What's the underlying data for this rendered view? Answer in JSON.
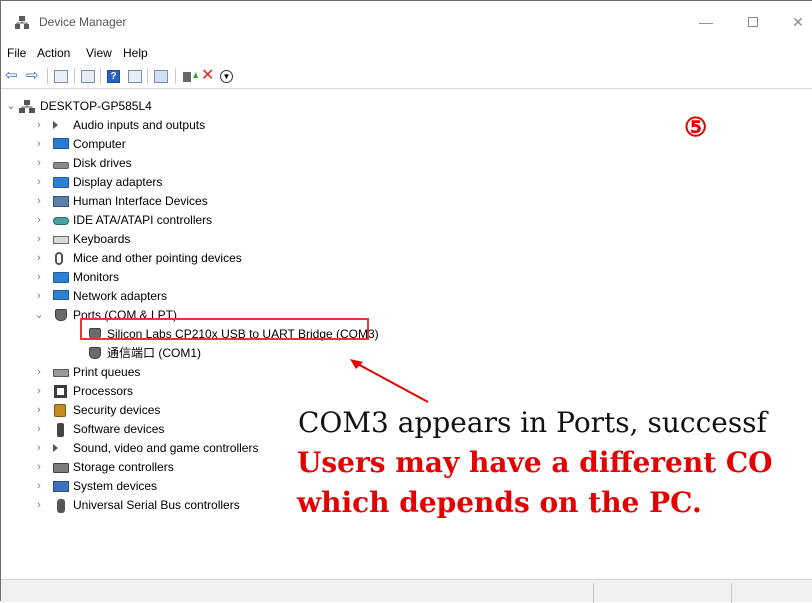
{
  "window": {
    "title": "Device Manager"
  },
  "menu": {
    "file": "File",
    "action": "Action",
    "view": "View",
    "help": "Help"
  },
  "tree": {
    "root": "DESKTOP-GP585L4",
    "categories": [
      {
        "label": "Audio inputs and outputs",
        "icon": "speaker-icon"
      },
      {
        "label": "Computer",
        "icon": "computer-icon"
      },
      {
        "label": "Disk drives",
        "icon": "disk-icon"
      },
      {
        "label": "Display adapters",
        "icon": "display-icon"
      },
      {
        "label": "Human Interface Devices",
        "icon": "hid-icon"
      },
      {
        "label": "IDE ATA/ATAPI controllers",
        "icon": "ide-icon"
      },
      {
        "label": "Keyboards",
        "icon": "keyboard-icon"
      },
      {
        "label": "Mice and other pointing devices",
        "icon": "mouse-icon"
      },
      {
        "label": "Monitors",
        "icon": "monitor-icon"
      },
      {
        "label": "Network adapters",
        "icon": "network-icon"
      },
      {
        "label": "Ports (COM & LPT)",
        "icon": "port-icon"
      },
      {
        "label": "Print queues",
        "icon": "printer-icon"
      },
      {
        "label": "Processors",
        "icon": "processor-icon"
      },
      {
        "label": "Security devices",
        "icon": "security-icon"
      },
      {
        "label": "Software devices",
        "icon": "software-icon"
      },
      {
        "label": "Sound, video and game controllers",
        "icon": "sound-icon"
      },
      {
        "label": "Storage controllers",
        "icon": "storage-icon"
      },
      {
        "label": "System devices",
        "icon": "system-icon"
      },
      {
        "label": "Universal Serial Bus controllers",
        "icon": "usb-icon"
      }
    ],
    "ports_children": [
      "Silicon Labs CP210x USB to UART Bridge (COM3)",
      "通信端口 (COM1)"
    ]
  },
  "annotations": {
    "step": "⑤",
    "line1": "COM3 appears in Ports, successf",
    "line2": "Users may have a different CO",
    "line3": "which depends on the PC.",
    "highlight_color": "#e23a3a"
  },
  "colors": {
    "accent": "#e40000"
  }
}
